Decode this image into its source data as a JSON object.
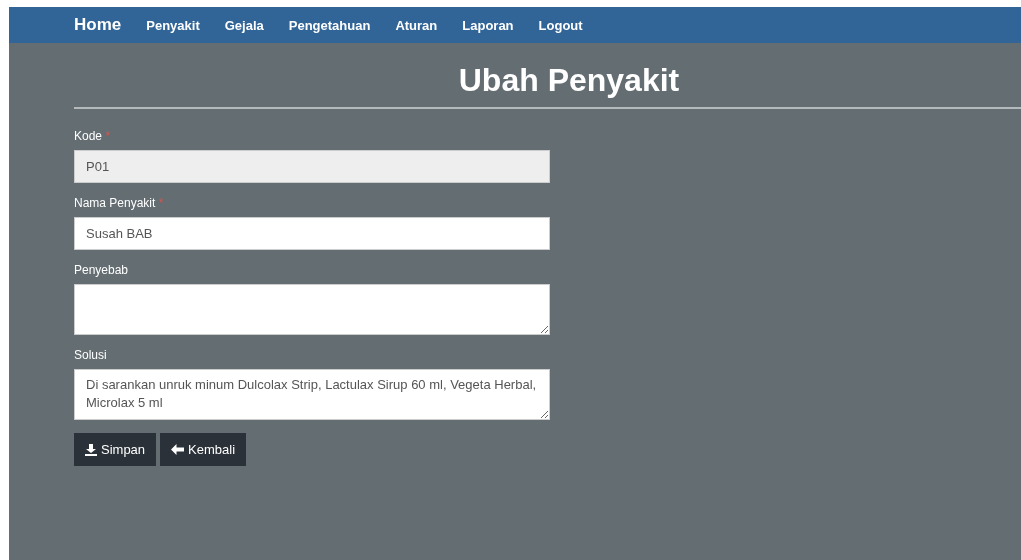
{
  "nav": {
    "brand": "Home",
    "items": [
      "Penyakit",
      "Gejala",
      "Pengetahuan",
      "Aturan",
      "Laporan",
      "Logout"
    ]
  },
  "title": "Ubah Penyakit",
  "fields": [
    {
      "kind": "input",
      "label": "Kode",
      "required_mark": "*",
      "disabled": true,
      "value": "P01"
    },
    {
      "kind": "input",
      "label": "Nama Penyakit",
      "required_mark": "*",
      "disabled": false,
      "value": "Susah BAB"
    },
    {
      "kind": "textarea",
      "label": "Penyebab",
      "disabled": false
    },
    {
      "kind": "textarea",
      "label": "Solusi",
      "disabled": false,
      "value": "Di sarankan unruk minum Dulcolax Strip, Lactulax Sirup 60 ml, Vegeta Herbal, Microlax 5 ml"
    }
  ],
  "buttons": [
    {
      "kind": "save",
      "label": "Simpan"
    },
    {
      "kind": "back",
      "label": "Kembali"
    }
  ]
}
